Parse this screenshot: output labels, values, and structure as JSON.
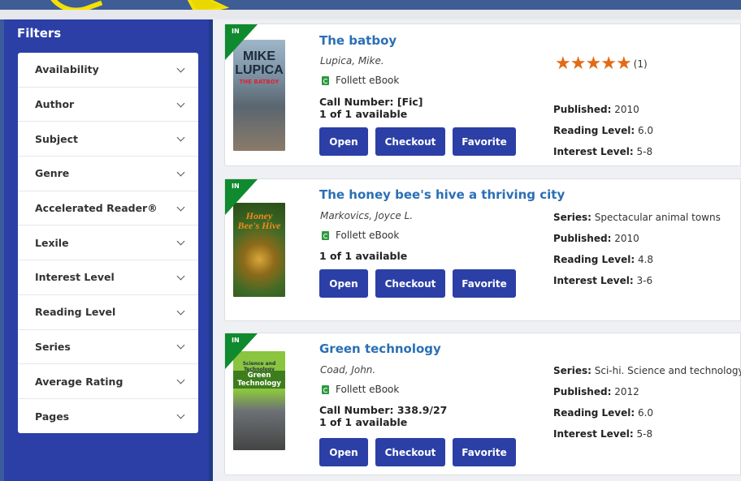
{
  "sidebar": {
    "title": "Filters",
    "items": [
      {
        "label": "Availability"
      },
      {
        "label": "Author"
      },
      {
        "label": "Subject"
      },
      {
        "label": "Genre"
      },
      {
        "label": "Accelerated Reader®"
      },
      {
        "label": "Lexile"
      },
      {
        "label": "Interest Level"
      },
      {
        "label": "Reading Level"
      },
      {
        "label": "Series"
      },
      {
        "label": "Average Rating"
      },
      {
        "label": "Pages"
      }
    ]
  },
  "buttons": {
    "open": "Open",
    "checkout": "Checkout",
    "favorite": "Favorite"
  },
  "colors": {
    "brand": "#2b3fa6",
    "link": "#2a6fb5",
    "flag": "#0f8a2e",
    "star": "#e36b16"
  },
  "results": [
    {
      "flag": "IN",
      "cover_text": "MIKE LUPICA",
      "cover_sub": "THE BATBOY",
      "title": "The batboy",
      "author": "Lupica, Mike.",
      "format": "Follett eBook",
      "call_number": "Call Number: [Fic]",
      "availability": "1 of 1 available",
      "rating_stars": 5,
      "rating_count": "(1)",
      "published_label": "Published:",
      "published": "2010",
      "reading_label": "Reading Level:",
      "reading": "6.0",
      "interest_label": "Interest Level:",
      "interest": "5-8"
    },
    {
      "flag": "IN",
      "cover_text": "Honey Bee's Hive",
      "title": "The honey bee's hive a thriving city",
      "author": "Markovics, Joyce L.",
      "format": "Follett eBook",
      "availability": "1 of 1 available",
      "series_label": "Series:",
      "series": "Spectacular animal towns",
      "published_label": "Published:",
      "published": "2010",
      "reading_label": "Reading Level:",
      "reading": "4.8",
      "interest_label": "Interest Level:",
      "interest": "3-6"
    },
    {
      "flag": "IN",
      "cover_top": "Science and Technology",
      "cover_text": "Green Technology",
      "title": "Green technology",
      "author": "Coad, John.",
      "format": "Follett eBook",
      "call_number": "Call Number: 338.9/27",
      "availability": "1 of 1 available",
      "series_label": "Series:",
      "series": "Sci-hi. Science and technology",
      "published_label": "Published:",
      "published": "2012",
      "reading_label": "Reading Level:",
      "reading": "6.0",
      "interest_label": "Interest Level:",
      "interest": "5-8"
    }
  ]
}
